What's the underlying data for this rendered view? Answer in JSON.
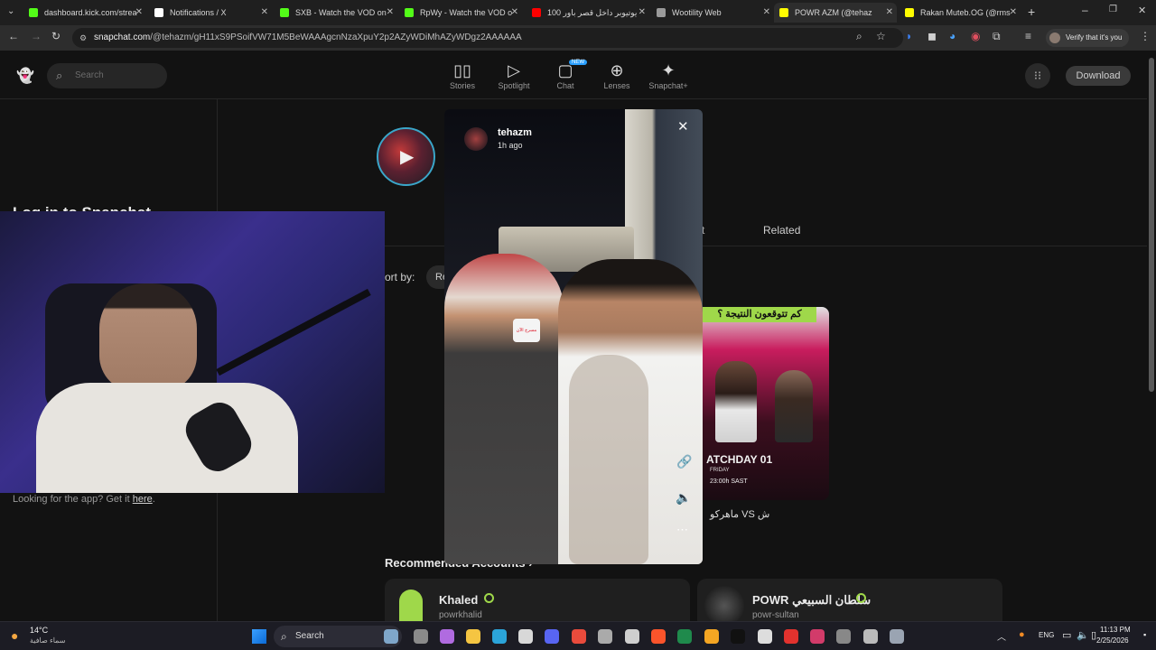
{
  "browser": {
    "tabs": [
      {
        "title": "dashboard.kick.com/strea",
        "color": "#53fc18",
        "active": false
      },
      {
        "title": "Notifications / X",
        "color": "#ffffff",
        "active": false
      },
      {
        "title": "SXB - Watch the VOD on",
        "color": "#53fc18",
        "active": false
      },
      {
        "title": "RpWy - Watch the VOD o",
        "color": "#53fc18",
        "active": false
      },
      {
        "title": "100 يوتيوبر داخل قصر باور",
        "color": "#ff0000",
        "active": false
      },
      {
        "title": "Wootility Web",
        "color": "#9a9a9a",
        "active": false
      },
      {
        "title": "POWR AZM (@tehaz",
        "color": "#fffc00",
        "active": true
      },
      {
        "title": "Rakan Muteb.OG (@rms",
        "color": "#fffc00",
        "active": false
      }
    ],
    "url_host": "snapchat.com",
    "url_path": "/@tehazm/gH11xS9PSoifVW71M5BeWAAAgcnNzaXpuY2p2AZyWDiMhAZyWDgz2AAAAAA",
    "profile_label": "Verify that it's you"
  },
  "snap": {
    "search_placeholder": "Search",
    "nav": [
      {
        "label": "Stories",
        "icon": "stories-icon"
      },
      {
        "label": "Spotlight",
        "icon": "spotlight-icon"
      },
      {
        "label": "Chat",
        "icon": "chat-icon",
        "badge": "NEW"
      },
      {
        "label": "Lenses",
        "icon": "lenses-icon"
      },
      {
        "label": "Snapchat+",
        "icon": "snapchat-plus-icon"
      }
    ],
    "download_label": "Download",
    "left_heading_partial": "Log in to Snapchat",
    "get_app_text": "Looking for the app? Get it ",
    "get_app_link": "here",
    "tab_related": "Related",
    "tab_partial": "t",
    "sort_label": "ort by:",
    "sort_value": "Re",
    "thumb_caption": "ماهركو VS ش",
    "thumb_headline": "كم تتوقعون النتيجة ؟",
    "thumb_matchday": "ATCHDAY 01",
    "thumb_day": "FRIDAY",
    "thumb_time": "23:00h SAST",
    "recommended_heading": "Recommended Accounts",
    "accounts": [
      {
        "name": "Khaled",
        "handle": "powrkhalid"
      },
      {
        "name": "POWR سلطان السبيعي",
        "handle": "powr-sultan"
      }
    ]
  },
  "story": {
    "username": "tehazm",
    "time_ago": "1h ago",
    "mic_label": "مسرح الآن"
  },
  "taskbar": {
    "weather_temp": "14°C",
    "weather_desc": "سماء صافية",
    "search_label": "Search",
    "lang": "ENG",
    "time": "11:13 PM",
    "date": "2/25/2026"
  }
}
